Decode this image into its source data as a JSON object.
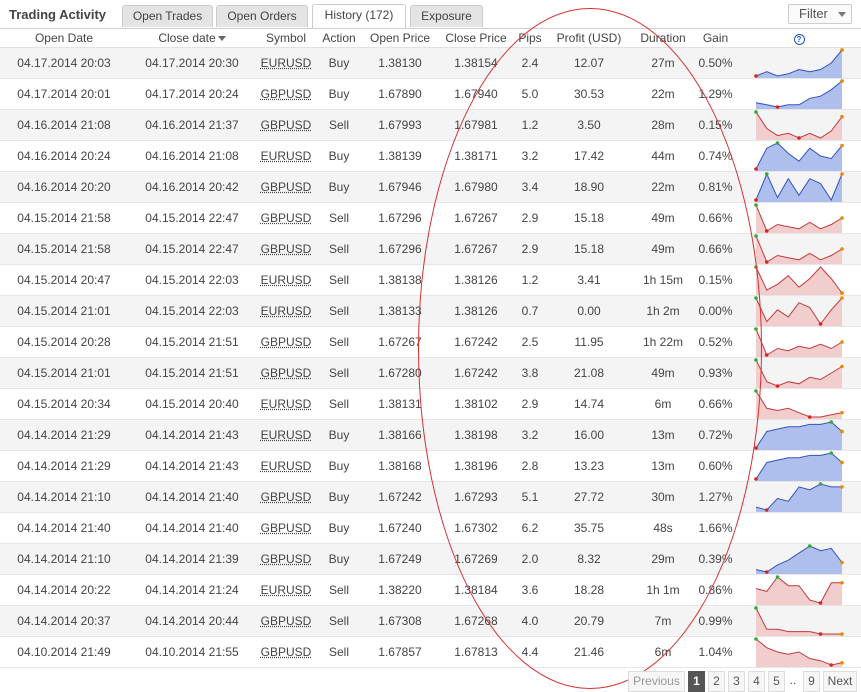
{
  "header": {
    "title": "Trading Activity",
    "tabs": [
      "Open Trades",
      "Open Orders",
      "History (172)",
      "Exposure"
    ],
    "active_tab": 2,
    "filter_label": "Filter"
  },
  "columns": {
    "open_date": "Open Date",
    "close_date": "Close date",
    "symbol": "Symbol",
    "action": "Action",
    "open_price": "Open Price",
    "close_price": "Close Price",
    "pips": "Pips",
    "profit": "Profit (USD)",
    "duration": "Duration",
    "gain": "Gain",
    "help": "?"
  },
  "rows": [
    {
      "open_date": "04.17.2014 20:03",
      "close_date": "04.17.2014 20:30",
      "symbol": "EURUSD",
      "action": "Buy",
      "open_price": "1.38130",
      "close_price": "1.38154",
      "pips": "2.4",
      "profit": "12.07",
      "duration": "27m",
      "gain": "0.50%",
      "spark": [
        3,
        5,
        3,
        4,
        6,
        5,
        6,
        9,
        15
      ],
      "dir": "up"
    },
    {
      "open_date": "04.17.2014 20:01",
      "close_date": "04.17.2014 20:24",
      "symbol": "GBPUSD",
      "action": "Buy",
      "open_price": "1.67890",
      "close_price": "1.67940",
      "pips": "5.0",
      "profit": "30.53",
      "duration": "22m",
      "gain": "1.29%",
      "spark": [
        4,
        3,
        2,
        3,
        3,
        6,
        7,
        10,
        14
      ],
      "dir": "up"
    },
    {
      "open_date": "04.16.2014 21:08",
      "close_date": "04.16.2014 21:37",
      "symbol": "GBPUSD",
      "action": "Sell",
      "open_price": "1.67993",
      "close_price": "1.67981",
      "pips": "1.2",
      "profit": "3.50",
      "duration": "28m",
      "gain": "0.15%",
      "spark": [
        14,
        7,
        4,
        5,
        3,
        5,
        3,
        6,
        12
      ],
      "dir": "down"
    },
    {
      "open_date": "04.16.2014 20:24",
      "close_date": "04.16.2014 21:08",
      "symbol": "EURUSD",
      "action": "Buy",
      "open_price": "1.38139",
      "close_price": "1.38171",
      "pips": "3.2",
      "profit": "17.42",
      "duration": "44m",
      "gain": "0.74%",
      "spark": [
        4,
        12,
        14,
        10,
        7,
        12,
        9,
        8,
        13
      ],
      "dir": "up"
    },
    {
      "open_date": "04.16.2014 20:20",
      "close_date": "04.16.2014 20:42",
      "symbol": "GBPUSD",
      "action": "Buy",
      "open_price": "1.67946",
      "close_price": "1.67980",
      "pips": "3.4",
      "profit": "18.90",
      "duration": "22m",
      "gain": "0.81%",
      "spark": [
        3,
        14,
        4,
        12,
        5,
        12,
        10,
        3,
        14
      ],
      "dir": "up"
    },
    {
      "open_date": "04.15.2014 21:58",
      "close_date": "04.15.2014 22:47",
      "symbol": "GBPUSD",
      "action": "Sell",
      "open_price": "1.67296",
      "close_price": "1.67267",
      "pips": "2.9",
      "profit": "15.18",
      "duration": "49m",
      "gain": "0.66%",
      "spark": [
        14,
        2,
        5,
        4,
        3,
        6,
        3,
        5,
        8
      ],
      "dir": "down"
    },
    {
      "open_date": "04.15.2014 21:58",
      "close_date": "04.15.2014 22:47",
      "symbol": "GBPUSD",
      "action": "Sell",
      "open_price": "1.67296",
      "close_price": "1.67267",
      "pips": "2.9",
      "profit": "15.18",
      "duration": "49m",
      "gain": "0.66%",
      "spark": [
        14,
        2,
        5,
        4,
        3,
        6,
        3,
        5,
        8
      ],
      "dir": "down"
    },
    {
      "open_date": "04.15.2014 20:47",
      "close_date": "04.15.2014 22:03",
      "symbol": "EURUSD",
      "action": "Sell",
      "open_price": "1.38138",
      "close_price": "1.38126",
      "pips": "1.2",
      "profit": "3.41",
      "duration": "1h 15m",
      "gain": "0.15%",
      "spark": [
        12,
        4,
        6,
        9,
        5,
        8,
        12,
        8,
        3
      ],
      "dir": "down"
    },
    {
      "open_date": "04.15.2014 21:01",
      "close_date": "04.15.2014 22:03",
      "symbol": "EURUSD",
      "action": "Sell",
      "open_price": "1.38133",
      "close_price": "1.38126",
      "pips": "0.7",
      "profit": "0.00",
      "duration": "1h 2m",
      "gain": "0.00%",
      "spark": [
        14,
        4,
        9,
        6,
        12,
        10,
        3,
        9,
        14
      ],
      "dir": "down"
    },
    {
      "open_date": "04.15.2014 20:28",
      "close_date": "04.15.2014 21:51",
      "symbol": "GBPUSD",
      "action": "Sell",
      "open_price": "1.67267",
      "close_price": "1.67242",
      "pips": "2.5",
      "profit": "11.95",
      "duration": "1h 22m",
      "gain": "0.52%",
      "spark": [
        14,
        2,
        5,
        4,
        6,
        5,
        7,
        5,
        8
      ],
      "dir": "down"
    },
    {
      "open_date": "04.15.2014 21:01",
      "close_date": "04.15.2014 21:51",
      "symbol": "GBPUSD",
      "action": "Sell",
      "open_price": "1.67280",
      "close_price": "1.67242",
      "pips": "3.8",
      "profit": "21.08",
      "duration": "49m",
      "gain": "0.93%",
      "spark": [
        14,
        4,
        2,
        4,
        3,
        6,
        5,
        8,
        11
      ],
      "dir": "down"
    },
    {
      "open_date": "04.15.2014 20:34",
      "close_date": "04.15.2014 20:40",
      "symbol": "EURUSD",
      "action": "Sell",
      "open_price": "1.38131",
      "close_price": "1.38102",
      "pips": "2.9",
      "profit": "14.74",
      "duration": "6m",
      "gain": "0.66%",
      "spark": [
        14,
        6,
        5,
        6,
        4,
        2,
        2,
        3,
        4
      ],
      "dir": "down"
    },
    {
      "open_date": "04.14.2014 21:29",
      "close_date": "04.14.2014 21:43",
      "symbol": "EURUSD",
      "action": "Buy",
      "open_price": "1.38166",
      "close_price": "1.38198",
      "pips": "3.2",
      "profit": "16.00",
      "duration": "13m",
      "gain": "0.72%",
      "spark": [
        2,
        9,
        10,
        11,
        11,
        12,
        12,
        13,
        9
      ],
      "dir": "up"
    },
    {
      "open_date": "04.14.2014 21:29",
      "close_date": "04.14.2014 21:43",
      "symbol": "EURUSD",
      "action": "Buy",
      "open_price": "1.38168",
      "close_price": "1.38196",
      "pips": "2.8",
      "profit": "13.23",
      "duration": "13m",
      "gain": "0.60%",
      "spark": [
        2,
        9,
        10,
        11,
        11,
        12,
        12,
        13,
        9
      ],
      "dir": "up"
    },
    {
      "open_date": "04.14.2014 21:10",
      "close_date": "04.14.2014 21:40",
      "symbol": "GBPUSD",
      "action": "Buy",
      "open_price": "1.67242",
      "close_price": "1.67293",
      "pips": "5.1",
      "profit": "27.72",
      "duration": "30m",
      "gain": "1.27%",
      "spark": [
        3,
        2,
        6,
        5,
        10,
        9,
        11,
        10,
        10
      ],
      "dir": "up"
    },
    {
      "open_date": "04.14.2014 21:40",
      "close_date": "04.14.2014 21:40",
      "symbol": "GBPUSD",
      "action": "Buy",
      "open_price": "1.67240",
      "close_price": "1.67302",
      "pips": "6.2",
      "profit": "35.75",
      "duration": "48s",
      "gain": "1.66%",
      "spark": [],
      "dir": "none"
    },
    {
      "open_date": "04.14.2014 21:10",
      "close_date": "04.14.2014 21:39",
      "symbol": "GBPUSD",
      "action": "Buy",
      "open_price": "1.67249",
      "close_price": "1.67269",
      "pips": "2.0",
      "profit": "8.32",
      "duration": "29m",
      "gain": "0.39%",
      "spark": [
        3,
        2,
        5,
        7,
        10,
        13,
        11,
        12,
        6
      ],
      "dir": "up"
    },
    {
      "open_date": "04.14.2014 20:22",
      "close_date": "04.14.2014 21:24",
      "symbol": "EURUSD",
      "action": "Sell",
      "open_price": "1.38220",
      "close_price": "1.38184",
      "pips": "3.6",
      "profit": "18.28",
      "duration": "1h 1m",
      "gain": "0.86%",
      "spark": [
        8,
        7,
        12,
        9,
        9,
        4,
        3,
        10,
        10
      ],
      "dir": "down"
    },
    {
      "open_date": "04.14.2014 20:37",
      "close_date": "04.14.2014 20:44",
      "symbol": "GBPUSD",
      "action": "Sell",
      "open_price": "1.67308",
      "close_price": "1.67268",
      "pips": "4.0",
      "profit": "20.79",
      "duration": "7m",
      "gain": "0.99%",
      "spark": [
        14,
        5,
        5,
        4,
        4,
        4,
        3,
        3,
        3
      ],
      "dir": "down"
    },
    {
      "open_date": "04.10.2014 21:49",
      "close_date": "04.10.2014 21:55",
      "symbol": "GBPUSD",
      "action": "Sell",
      "open_price": "1.67857",
      "close_price": "1.67813",
      "pips": "4.4",
      "profit": "21.46",
      "duration": "6m",
      "gain": "1.04%",
      "spark": [
        14,
        10,
        8,
        7,
        8,
        5,
        4,
        2,
        3
      ],
      "dir": "down"
    }
  ],
  "pagination": {
    "previous": "Previous",
    "pages": [
      "1",
      "2",
      "3",
      "4",
      "5",
      "..",
      "9"
    ],
    "active": "1",
    "next": "Next"
  },
  "colors": {
    "buy_fill": "#aebfed",
    "buy_line": "#3355bb",
    "sell_fill": "#f1cdcd",
    "sell_line": "#c23b3b",
    "positive_text": "#3a9a3a",
    "annotation_ellipse": "#d4302f"
  }
}
